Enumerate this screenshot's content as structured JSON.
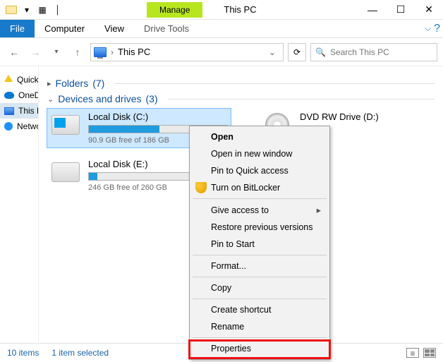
{
  "titlebar": {
    "manage": "Manage",
    "title": "This PC"
  },
  "ribbon": {
    "file": "File",
    "computer": "Computer",
    "view": "View",
    "drive_tools": "Drive Tools"
  },
  "nav": {
    "location": "This PC",
    "search_placeholder": "Search This PC"
  },
  "sidebar": {
    "items": [
      {
        "label": "Quick access"
      },
      {
        "label": "OneDrive"
      },
      {
        "label": "This PC"
      },
      {
        "label": "Network"
      }
    ]
  },
  "groups": {
    "folders": {
      "label": "Folders",
      "count": "(7)"
    },
    "devices": {
      "label": "Devices and drives",
      "count": "(3)"
    }
  },
  "drives": {
    "c": {
      "name": "Local Disk (C:)",
      "free": "90.9 GB free of 186 GB",
      "fill_pct": 51
    },
    "e": {
      "name": "Local Disk (E:)",
      "free": "246 GB free of 260 GB",
      "fill_pct": 6
    },
    "dvd": {
      "name": "DVD RW Drive (D:)"
    }
  },
  "context_menu": {
    "open": "Open",
    "open_new": "Open in new window",
    "pin_quick": "Pin to Quick access",
    "bitlocker": "Turn on BitLocker",
    "give_access": "Give access to",
    "restore": "Restore previous versions",
    "pin_start": "Pin to Start",
    "format": "Format...",
    "copy": "Copy",
    "shortcut": "Create shortcut",
    "rename": "Rename",
    "properties": "Properties"
  },
  "status": {
    "items": "10 items",
    "selected": "1 item selected"
  }
}
